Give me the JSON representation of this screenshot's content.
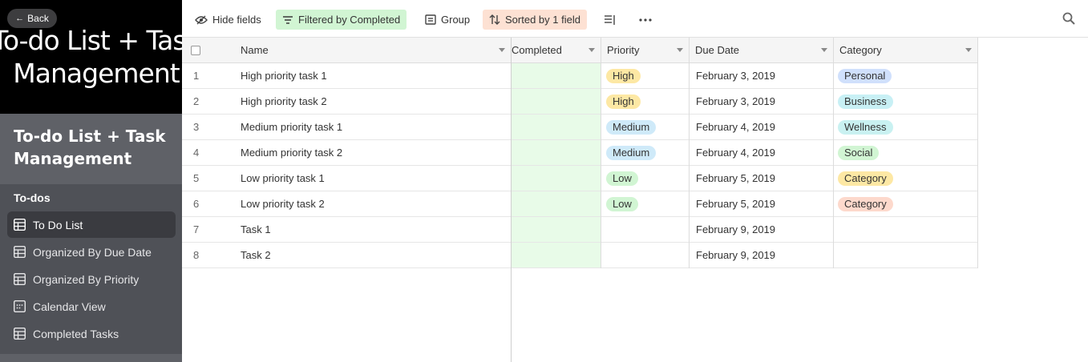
{
  "sidebar": {
    "back_label": "Back",
    "hero_title": "To-do List + Task Management",
    "title": "To-do List + Task Management",
    "section": "To-dos",
    "items": [
      {
        "label": "To Do List",
        "icon": "grid-icon",
        "active": true
      },
      {
        "label": "Organized By Due Date",
        "icon": "grid-icon",
        "active": false
      },
      {
        "label": "Organized By Priority",
        "icon": "grid-icon",
        "active": false
      },
      {
        "label": "Calendar View",
        "icon": "calendar-icon",
        "active": false
      },
      {
        "label": "Completed Tasks",
        "icon": "grid-icon",
        "active": false
      }
    ]
  },
  "toolbar": {
    "hide_fields": "Hide fields",
    "filter": "Filtered by Completed",
    "group": "Group",
    "sort": "Sorted by 1 field"
  },
  "columns": {
    "name": "Name",
    "completed": "Completed",
    "priority": "Priority",
    "due_date": "Due Date",
    "category": "Category"
  },
  "rows": [
    {
      "num": "1",
      "name": "High priority task 1",
      "priority": "High",
      "due": "February 3, 2019",
      "category": "Personal"
    },
    {
      "num": "2",
      "name": "High priority task 2",
      "priority": "High",
      "due": "February 3, 2019",
      "category": "Business"
    },
    {
      "num": "3",
      "name": "Medium priority task 1",
      "priority": "Medium",
      "due": "February 4, 2019",
      "category": "Wellness"
    },
    {
      "num": "4",
      "name": "Medium priority task 2",
      "priority": "Medium",
      "due": "February 4, 2019",
      "category": "Social"
    },
    {
      "num": "5",
      "name": "Low priority task 1",
      "priority": "Low",
      "due": "February 5, 2019",
      "category": "Category"
    },
    {
      "num": "6",
      "name": "Low priority task 2",
      "priority": "Low",
      "due": "February 5, 2019",
      "category": "Category"
    },
    {
      "num": "7",
      "name": "Task 1",
      "priority": "",
      "due": "February 9, 2019",
      "category": ""
    },
    {
      "num": "8",
      "name": "Task 2",
      "priority": "",
      "due": "February 9, 2019",
      "category": ""
    }
  ],
  "colors": {
    "priority": {
      "High": "#fde8a4",
      "Medium": "#cfeaf9",
      "Low": "#d1f5d3"
    },
    "category": [
      "#d0e0fc",
      "#c8f0f5",
      "#c9f1f1",
      "#d1f5d3",
      "#fde8a4",
      "#fdd9cc"
    ],
    "filter_bg": "#d1f5d3",
    "sort_bg": "#fde1d3",
    "completed_bg": "#e8fbe8"
  }
}
